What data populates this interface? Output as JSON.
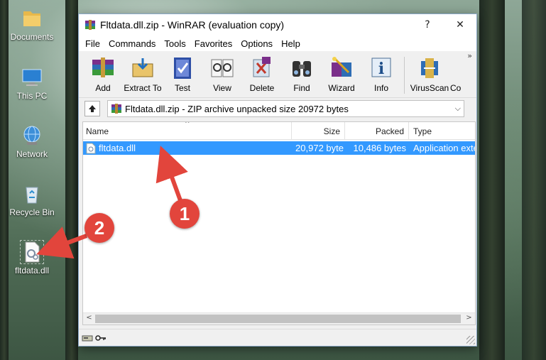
{
  "desktop": {
    "icons": [
      {
        "label": "Documents"
      },
      {
        "label": "This PC"
      },
      {
        "label": "Network"
      },
      {
        "label": "Recycle Bin"
      },
      {
        "label": "fltdata.dll"
      }
    ]
  },
  "window": {
    "title": "Fltdata.dll.zip - WinRAR (evaluation copy)",
    "help_glyph": "?",
    "close_glyph": "✕",
    "menu": [
      "File",
      "Commands",
      "Tools",
      "Favorites",
      "Options",
      "Help"
    ],
    "toolbar": [
      {
        "label": "Add",
        "icon": "add-archive-icon"
      },
      {
        "label": "Extract To",
        "icon": "extract-to-icon"
      },
      {
        "label": "Test",
        "icon": "test-icon"
      },
      {
        "label": "View",
        "icon": "view-icon"
      },
      {
        "label": "Delete",
        "icon": "delete-icon"
      },
      {
        "label": "Find",
        "icon": "find-icon"
      },
      {
        "label": "Wizard",
        "icon": "wizard-icon"
      },
      {
        "label": "Info",
        "icon": "info-icon"
      },
      {
        "label": "VirusScan",
        "icon": "virusscan-icon"
      },
      {
        "label": "Co",
        "icon": "comment-icon"
      }
    ],
    "toolbar_more": "»",
    "address": "Fltdata.dll.zip - ZIP archive unpacked size 20972 bytes",
    "address_dropdown": "⌵",
    "columns": [
      "Name",
      "Size",
      "Packed",
      "Type"
    ],
    "sort_caret": "^",
    "files": [
      {
        "name": "fltdata.dll",
        "size": "20,972 byte",
        "packed": "10,486 bytes",
        "type": "Application exte"
      }
    ],
    "scroll_left": "<",
    "scroll_right": ">"
  },
  "annotations": [
    {
      "number": "1",
      "color": "#e2453c"
    },
    {
      "number": "2",
      "color": "#e2453c"
    }
  ]
}
